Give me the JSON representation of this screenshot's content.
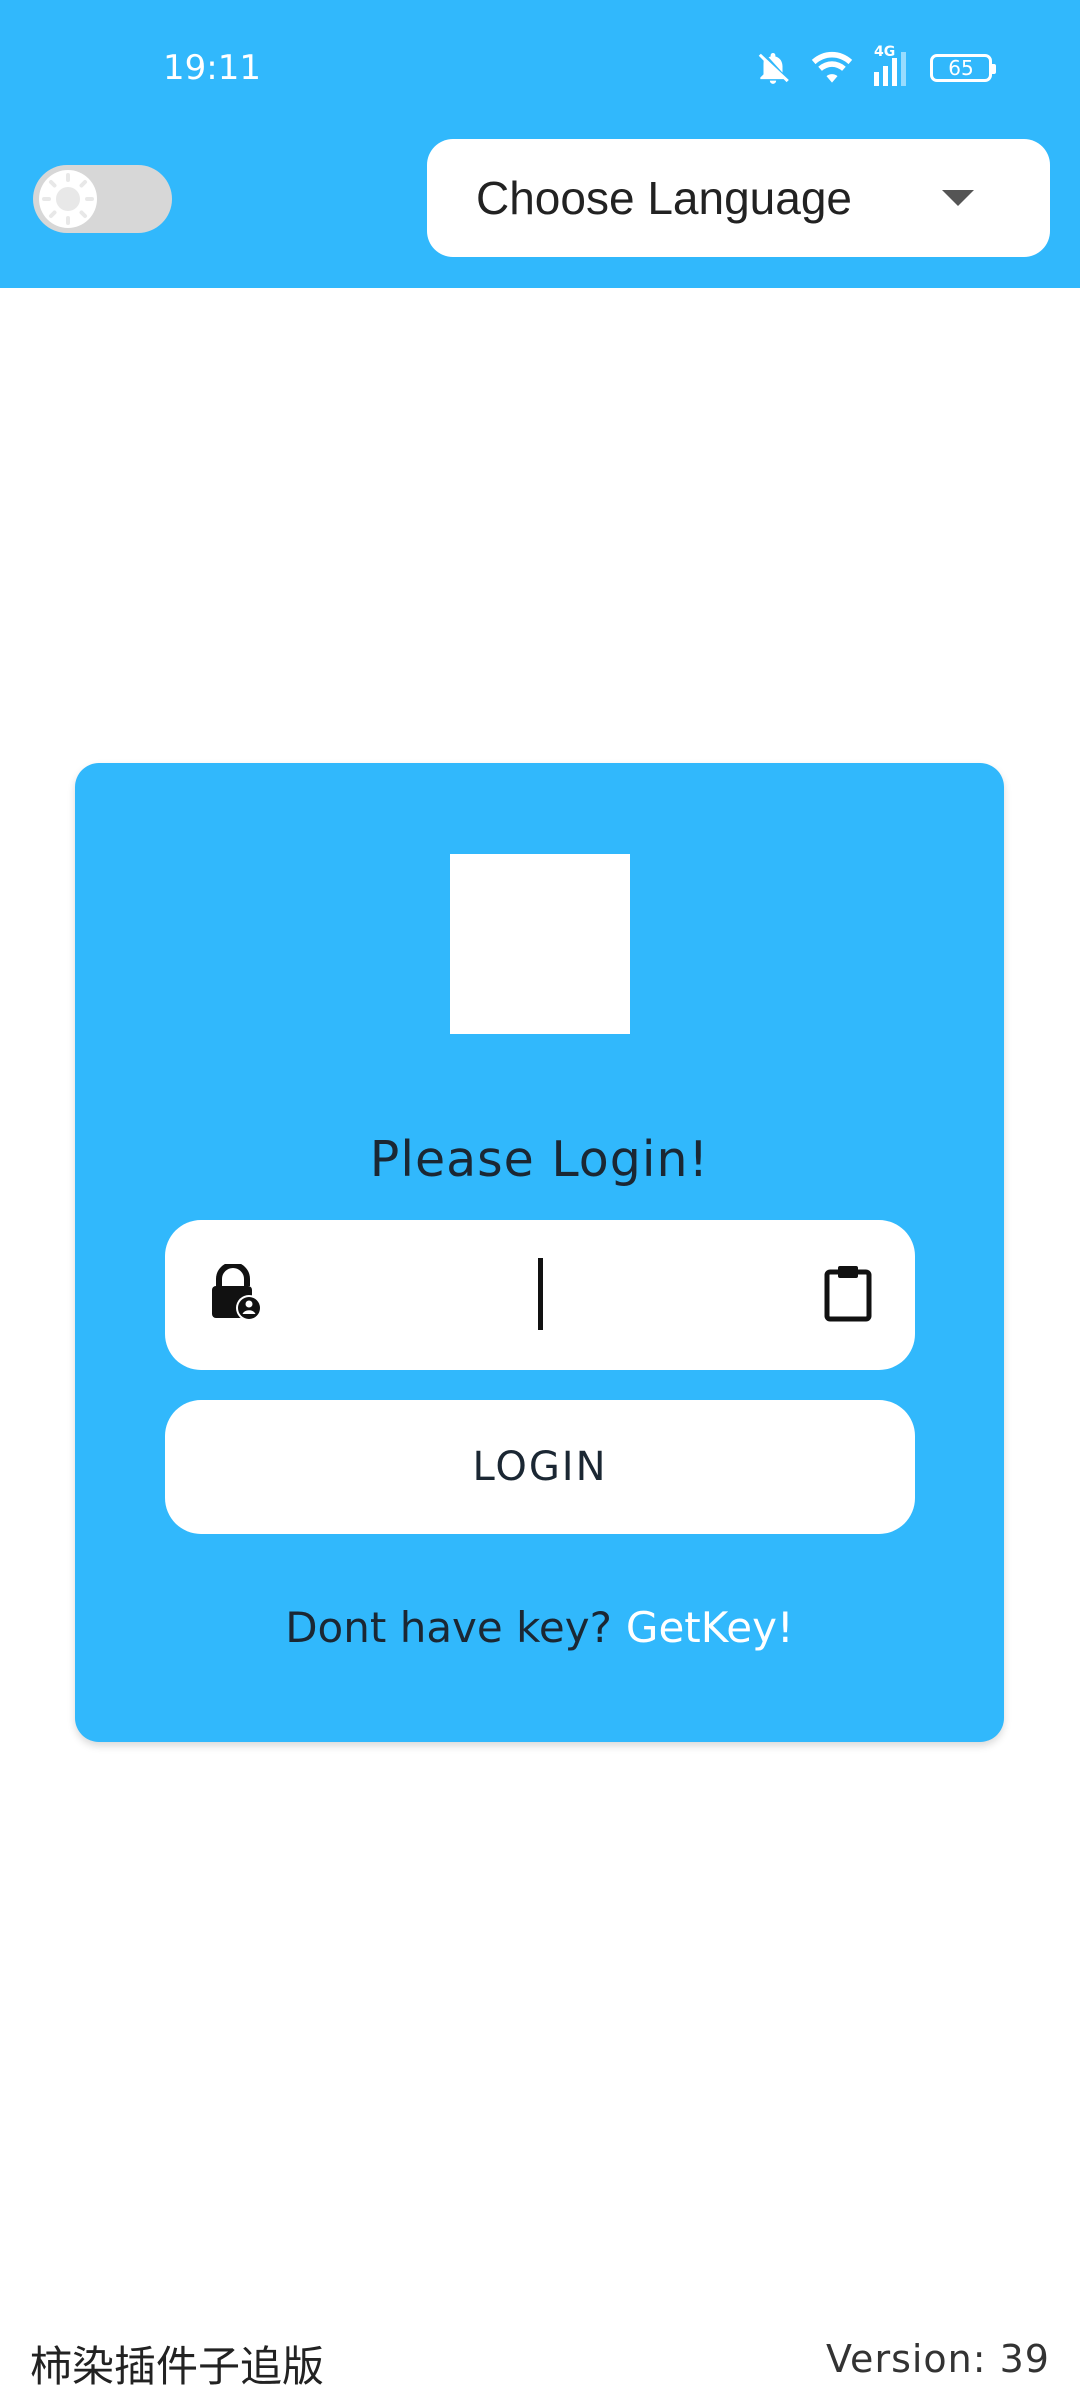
{
  "status_bar": {
    "time": "19:11",
    "network_label": "4G",
    "battery_level": "65",
    "icons": [
      "bell-off-icon",
      "wifi-icon",
      "cellular-signal-icon",
      "battery-icon"
    ]
  },
  "top_bar": {
    "background_color": "#31B8FC",
    "theme_toggle": {
      "state": "off",
      "icon": "sun-icon"
    },
    "language_select": {
      "label": "Choose Language",
      "icon": "chevron-down-icon"
    }
  },
  "login_card": {
    "background_color": "#31B8FC",
    "title": "Please Login!",
    "key_field": {
      "value": "",
      "placeholder": "",
      "left_icon": "lock-account-icon",
      "right_icon": "clipboard-icon"
    },
    "login_button_label": "LOGIN",
    "no_key_text": "Dont have key?",
    "get_key_label": "GetKey!"
  },
  "footer": {
    "left_text": "柿染插件子追版",
    "version_text": "Version: 39"
  }
}
